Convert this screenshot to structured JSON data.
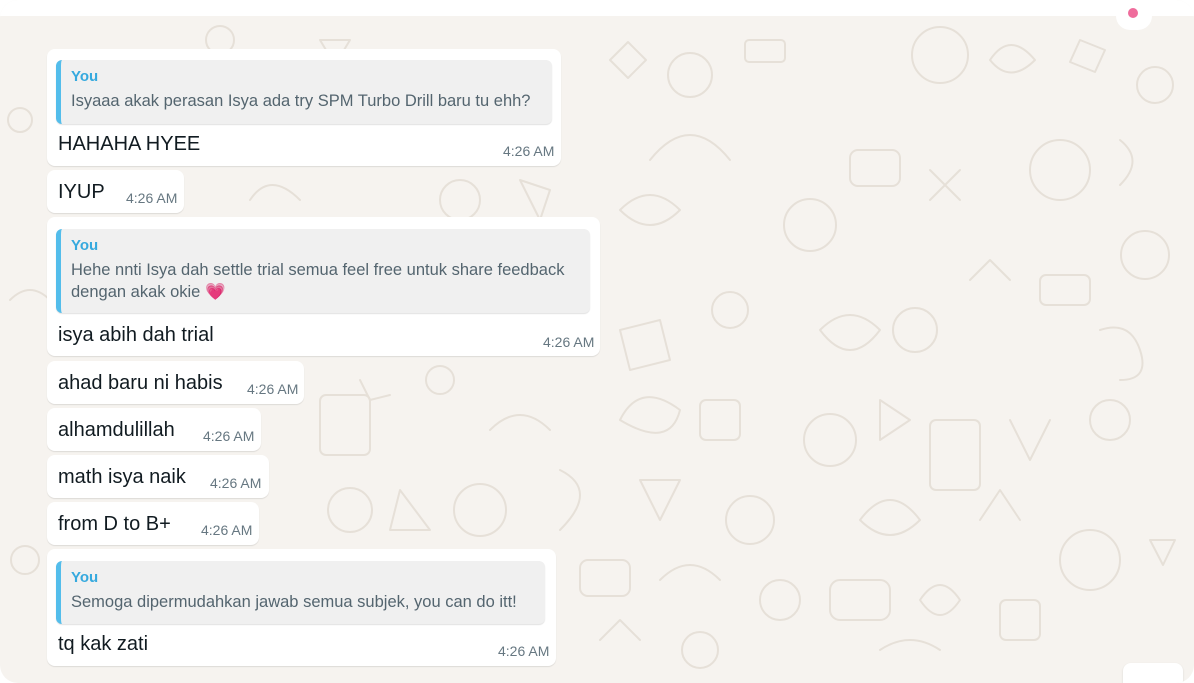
{
  "messages": [
    {
      "quote": {
        "author": "You",
        "lines": [
          "Isyaaa akak perasan Isya ada try SPM Turbo Drill baru tu ehh?"
        ]
      },
      "text": "HAHAHA HYEE",
      "time": "4:26 AM"
    },
    {
      "text": "IYUP",
      "time": "4:26 AM"
    },
    {
      "quote": {
        "author": "You",
        "lines": [
          "Hehe nnti Isya dah settle trial semua feel free untuk share feedback",
          "dengan akak okie"
        ],
        "emoji": "💗"
      },
      "text": "isya abih dah trial",
      "time": "4:26 AM"
    },
    {
      "text": "ahad baru ni habis",
      "time": "4:26 AM"
    },
    {
      "text": "alhamdulillah",
      "time": "4:26 AM"
    },
    {
      "text": "math isya naik",
      "time": "4:26 AM"
    },
    {
      "text": "from D to B+",
      "time": "4:26 AM"
    },
    {
      "quote": {
        "author": "You",
        "lines": [
          "Semoga dipermudahkan jawab semua subjek, you can do itt!"
        ]
      },
      "text": "tq kak zati",
      "time": "4:26 AM"
    }
  ],
  "colors": {
    "background": "#f6f3ef",
    "quote_accent": "#53bdeb",
    "quote_author": "#35a9de",
    "timestamp": "#667781"
  }
}
